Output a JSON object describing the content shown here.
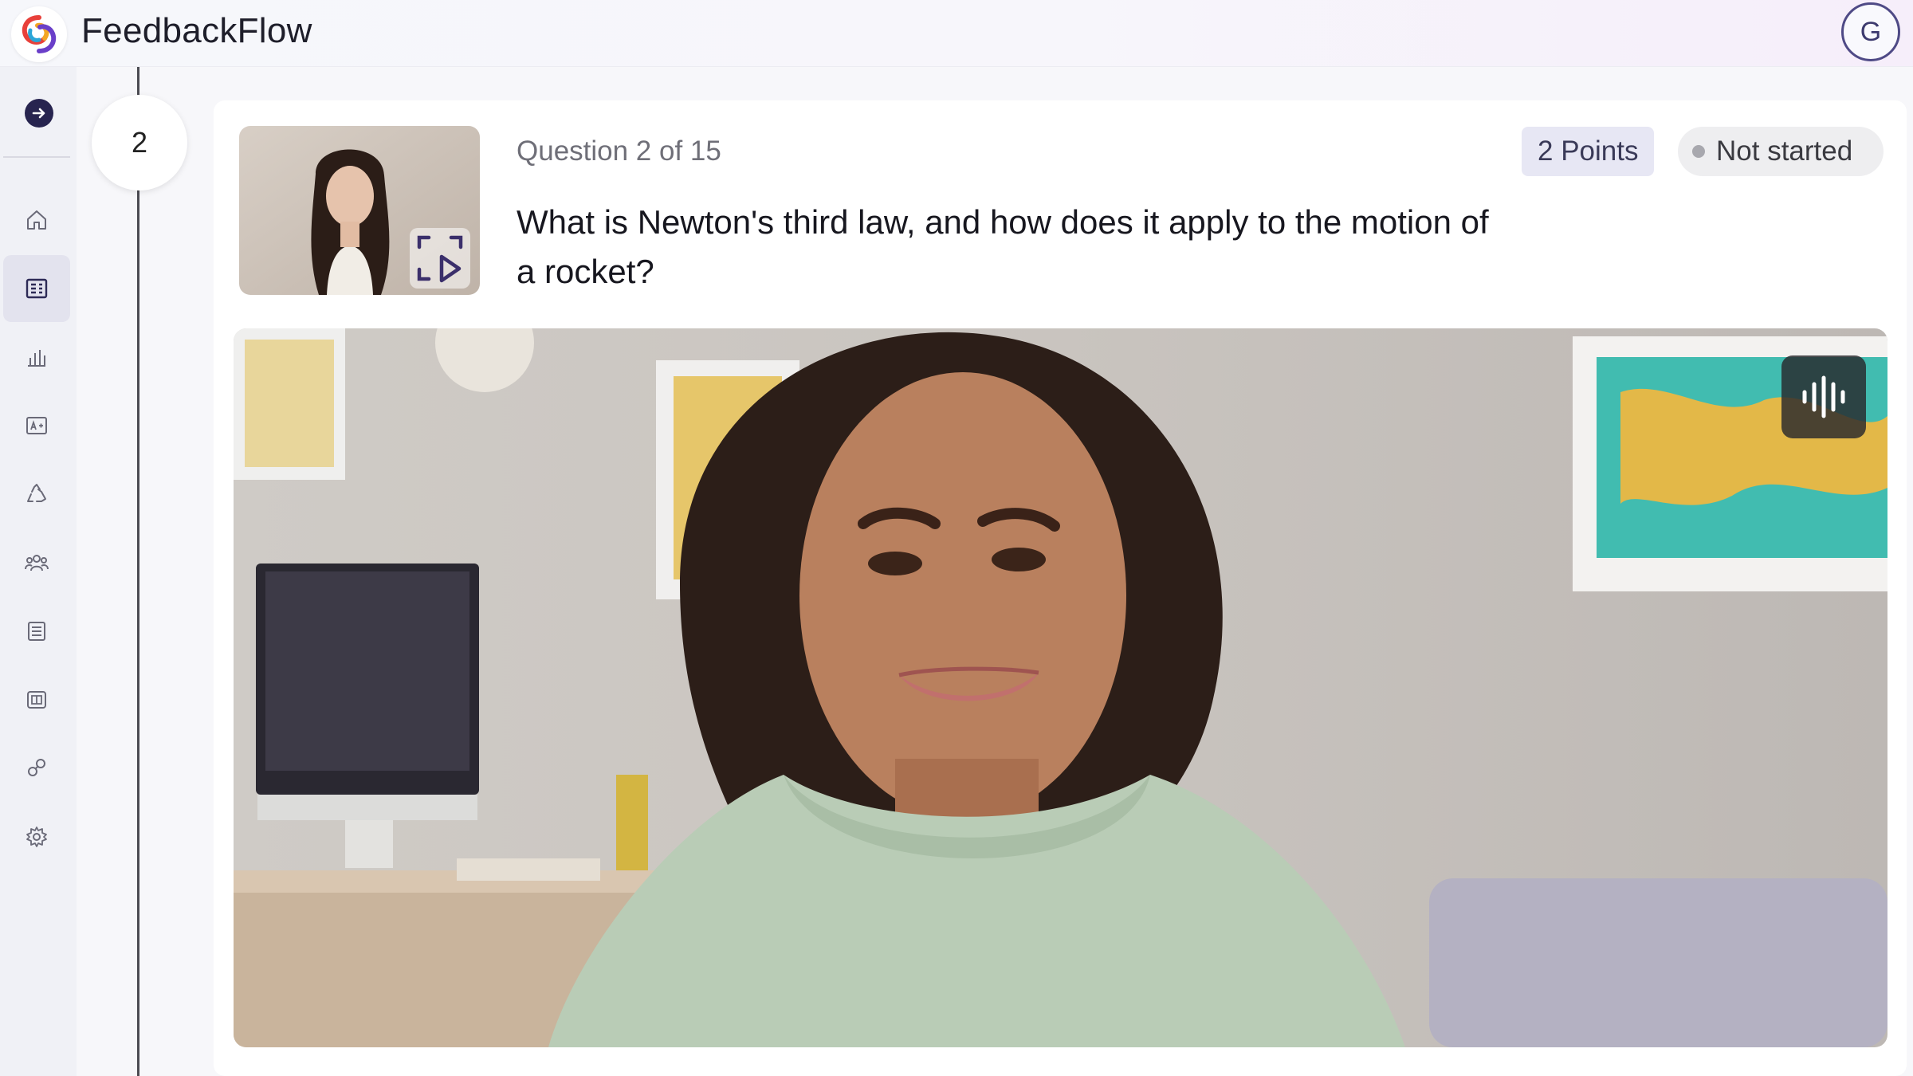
{
  "header": {
    "brand_name": "FeedbackFlow",
    "logo_icon": "swirl-logo-icon",
    "profile_initial": "G"
  },
  "sidebar": {
    "collapse_icon": "arrow-right-circle-icon",
    "items": [
      {
        "icon": "home-icon",
        "active": false
      },
      {
        "icon": "assessment-icon",
        "active": true
      },
      {
        "icon": "bar-chart-icon",
        "active": false
      },
      {
        "icon": "grade-icon",
        "active": false
      },
      {
        "icon": "recycle-icon",
        "active": false
      },
      {
        "icon": "users-icon",
        "active": false
      },
      {
        "icon": "list-icon",
        "active": false
      },
      {
        "icon": "book-icon",
        "active": false
      },
      {
        "icon": "integrations-icon",
        "active": false
      },
      {
        "icon": "settings-icon",
        "active": false
      }
    ]
  },
  "steps": {
    "current_step": "2"
  },
  "question": {
    "counter": "Question 2 of 15",
    "text": "What is Newton's third law, and how does it apply to the motion of a rocket?",
    "points": "2 Points",
    "status": "Not started",
    "thumbnail_icon": "expand-play-icon"
  },
  "video": {
    "audio_icon": "audio-waveform-icon"
  },
  "colors": {
    "accent": "#27244f",
    "points_bg": "#e7e7f4",
    "status_bg": "#eeeef0",
    "status_dot": "#a8a8ae"
  }
}
